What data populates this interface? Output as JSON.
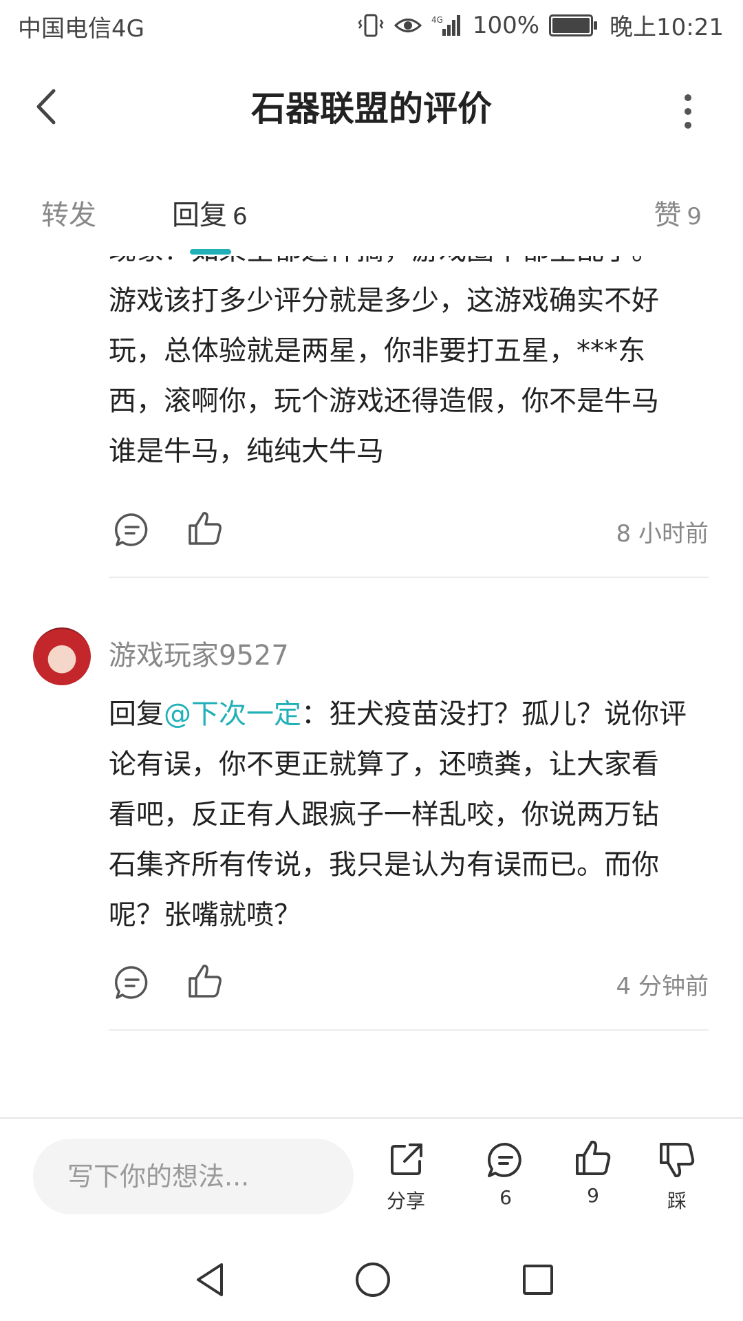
{
  "status_bar": {
    "carrier": "中国电信4G",
    "battery": "100%",
    "time": "晚上10:21"
  },
  "header": {
    "title": "石器联盟的评价",
    "back_icon": "chevron-left-icon",
    "more_icon": "more-vertical-icon"
  },
  "tabs": [
    {
      "label": "转发",
      "count": ""
    },
    {
      "label": "回复",
      "count": "6"
    },
    {
      "label": "赞",
      "count": "9"
    }
  ],
  "comments": [
    {
      "partial_top_line": "现象？如果全都这样搞，游戏圈不都全乱了。",
      "lines": [
        "游戏该打多少评分就是多少，这游戏确实不好",
        "玩，总体验就是两星，你非要打五星，***东",
        "西，滚啊你，玩个游戏还得造假，你不是牛马",
        "谁是牛马，纯纯大牛马"
      ],
      "time": "8 小时前"
    },
    {
      "username": "游戏玩家9527",
      "reply_prefix": "回复",
      "mention": "@下次一定",
      "first_line_rest": "：狂犬疫苗没打？孤儿？说你评",
      "lines": [
        "论有误，你不更正就算了，还喷粪，让大家看",
        "看吧，反正有人跟疯子一样乱咬，你说两万钻",
        "石集齐所有传说，我只是认为有误而已。而你",
        "呢？张嘴就喷？"
      ],
      "time": "4 分钟前"
    }
  ],
  "bottom_bar": {
    "input_placeholder": "写下你的想法...",
    "share_label": "分享",
    "comment_count": "6",
    "like_count": "9",
    "dislike_label": "踩"
  },
  "colors": {
    "accent": "#22b0b8",
    "text": "#222222",
    "muted": "#888888"
  }
}
